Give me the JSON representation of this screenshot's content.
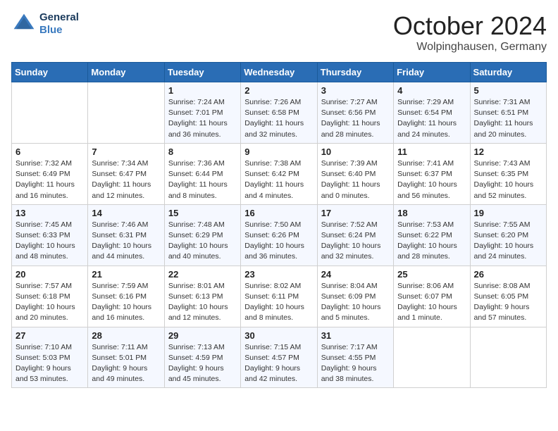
{
  "header": {
    "logo_line1": "General",
    "logo_line2": "Blue",
    "title": "October 2024",
    "location": "Wolpinghausen, Germany"
  },
  "weekdays": [
    "Sunday",
    "Monday",
    "Tuesday",
    "Wednesday",
    "Thursday",
    "Friday",
    "Saturday"
  ],
  "weeks": [
    [
      {
        "day": "",
        "info": ""
      },
      {
        "day": "",
        "info": ""
      },
      {
        "day": "1",
        "info": "Sunrise: 7:24 AM\nSunset: 7:01 PM\nDaylight: 11 hours and 36 minutes."
      },
      {
        "day": "2",
        "info": "Sunrise: 7:26 AM\nSunset: 6:58 PM\nDaylight: 11 hours and 32 minutes."
      },
      {
        "day": "3",
        "info": "Sunrise: 7:27 AM\nSunset: 6:56 PM\nDaylight: 11 hours and 28 minutes."
      },
      {
        "day": "4",
        "info": "Sunrise: 7:29 AM\nSunset: 6:54 PM\nDaylight: 11 hours and 24 minutes."
      },
      {
        "day": "5",
        "info": "Sunrise: 7:31 AM\nSunset: 6:51 PM\nDaylight: 11 hours and 20 minutes."
      }
    ],
    [
      {
        "day": "6",
        "info": "Sunrise: 7:32 AM\nSunset: 6:49 PM\nDaylight: 11 hours and 16 minutes."
      },
      {
        "day": "7",
        "info": "Sunrise: 7:34 AM\nSunset: 6:47 PM\nDaylight: 11 hours and 12 minutes."
      },
      {
        "day": "8",
        "info": "Sunrise: 7:36 AM\nSunset: 6:44 PM\nDaylight: 11 hours and 8 minutes."
      },
      {
        "day": "9",
        "info": "Sunrise: 7:38 AM\nSunset: 6:42 PM\nDaylight: 11 hours and 4 minutes."
      },
      {
        "day": "10",
        "info": "Sunrise: 7:39 AM\nSunset: 6:40 PM\nDaylight: 11 hours and 0 minutes."
      },
      {
        "day": "11",
        "info": "Sunrise: 7:41 AM\nSunset: 6:37 PM\nDaylight: 10 hours and 56 minutes."
      },
      {
        "day": "12",
        "info": "Sunrise: 7:43 AM\nSunset: 6:35 PM\nDaylight: 10 hours and 52 minutes."
      }
    ],
    [
      {
        "day": "13",
        "info": "Sunrise: 7:45 AM\nSunset: 6:33 PM\nDaylight: 10 hours and 48 minutes."
      },
      {
        "day": "14",
        "info": "Sunrise: 7:46 AM\nSunset: 6:31 PM\nDaylight: 10 hours and 44 minutes."
      },
      {
        "day": "15",
        "info": "Sunrise: 7:48 AM\nSunset: 6:29 PM\nDaylight: 10 hours and 40 minutes."
      },
      {
        "day": "16",
        "info": "Sunrise: 7:50 AM\nSunset: 6:26 PM\nDaylight: 10 hours and 36 minutes."
      },
      {
        "day": "17",
        "info": "Sunrise: 7:52 AM\nSunset: 6:24 PM\nDaylight: 10 hours and 32 minutes."
      },
      {
        "day": "18",
        "info": "Sunrise: 7:53 AM\nSunset: 6:22 PM\nDaylight: 10 hours and 28 minutes."
      },
      {
        "day": "19",
        "info": "Sunrise: 7:55 AM\nSunset: 6:20 PM\nDaylight: 10 hours and 24 minutes."
      }
    ],
    [
      {
        "day": "20",
        "info": "Sunrise: 7:57 AM\nSunset: 6:18 PM\nDaylight: 10 hours and 20 minutes."
      },
      {
        "day": "21",
        "info": "Sunrise: 7:59 AM\nSunset: 6:16 PM\nDaylight: 10 hours and 16 minutes."
      },
      {
        "day": "22",
        "info": "Sunrise: 8:01 AM\nSunset: 6:13 PM\nDaylight: 10 hours and 12 minutes."
      },
      {
        "day": "23",
        "info": "Sunrise: 8:02 AM\nSunset: 6:11 PM\nDaylight: 10 hours and 8 minutes."
      },
      {
        "day": "24",
        "info": "Sunrise: 8:04 AM\nSunset: 6:09 PM\nDaylight: 10 hours and 5 minutes."
      },
      {
        "day": "25",
        "info": "Sunrise: 8:06 AM\nSunset: 6:07 PM\nDaylight: 10 hours and 1 minute."
      },
      {
        "day": "26",
        "info": "Sunrise: 8:08 AM\nSunset: 6:05 PM\nDaylight: 9 hours and 57 minutes."
      }
    ],
    [
      {
        "day": "27",
        "info": "Sunrise: 7:10 AM\nSunset: 5:03 PM\nDaylight: 9 hours and 53 minutes."
      },
      {
        "day": "28",
        "info": "Sunrise: 7:11 AM\nSunset: 5:01 PM\nDaylight: 9 hours and 49 minutes."
      },
      {
        "day": "29",
        "info": "Sunrise: 7:13 AM\nSunset: 4:59 PM\nDaylight: 9 hours and 45 minutes."
      },
      {
        "day": "30",
        "info": "Sunrise: 7:15 AM\nSunset: 4:57 PM\nDaylight: 9 hours and 42 minutes."
      },
      {
        "day": "31",
        "info": "Sunrise: 7:17 AM\nSunset: 4:55 PM\nDaylight: 9 hours and 38 minutes."
      },
      {
        "day": "",
        "info": ""
      },
      {
        "day": "",
        "info": ""
      }
    ]
  ]
}
